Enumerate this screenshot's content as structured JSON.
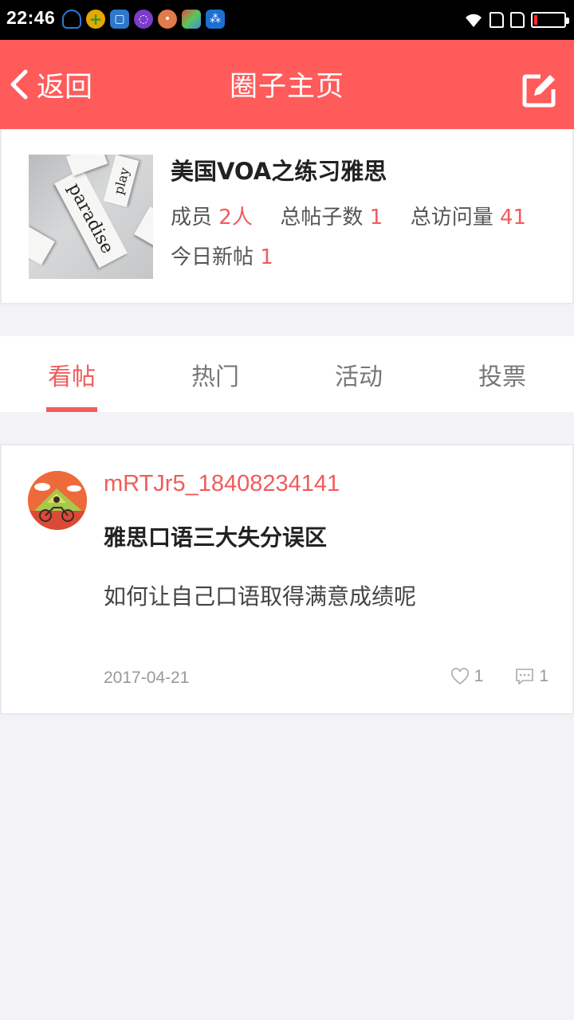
{
  "status_bar": {
    "time": "22:46",
    "notification_icons": [
      "headset-icon",
      "plus-icon",
      "scan-icon",
      "circle-icon",
      "gamepad-icon",
      "color-app-icon",
      "share-icon"
    ],
    "battery_level": 0.1
  },
  "app_bar": {
    "back_label": "返回",
    "title": "圈子主页",
    "edit_icon": "edit-icon",
    "color": "#ff5b5b"
  },
  "circle": {
    "name": "美国VOA之练习雅思",
    "members_label": "成员",
    "members_value": "2人",
    "posts_label": "总帖子数",
    "posts_value": "1",
    "visits_label": "总访问量",
    "visits_value": "41",
    "today_label": "今日新帖",
    "today_value": "1",
    "cover_words": [
      "paradise",
      "play"
    ]
  },
  "tabs": [
    {
      "label": "看帖",
      "active": true
    },
    {
      "label": "热门",
      "active": false
    },
    {
      "label": "活动",
      "active": false
    },
    {
      "label": "投票",
      "active": false
    }
  ],
  "posts": [
    {
      "author": "mRTJr5_18408234141",
      "title": "雅思口语三大失分误区",
      "excerpt": "如何让自己口语取得满意成绩呢",
      "date": "2017-04-21",
      "likes": "1",
      "comments": "1"
    }
  ],
  "colors": {
    "accent": "#f25b5b",
    "background": "#f2f2f7"
  }
}
